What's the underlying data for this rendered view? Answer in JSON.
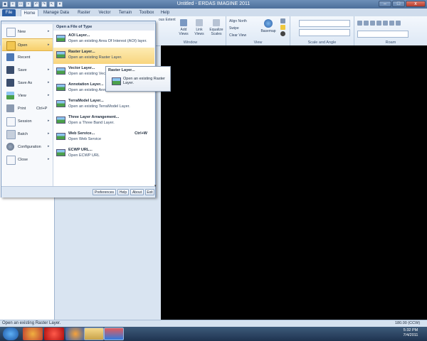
{
  "window": {
    "title": "Untitled - ERDAS IMAGINE 2011"
  },
  "tabs": [
    "File",
    "Home",
    "Manage Data",
    "Raster",
    "Vector",
    "Terrain",
    "Toolbox",
    "Help"
  ],
  "ribbon": {
    "groups": [
      "Window",
      "View",
      "Scale and Angle",
      "Roam"
    ],
    "buttons": {
      "add_views": "Add Views",
      "link_views": "Link Views",
      "equalize_scales": "Equalize Scales",
      "align_north": "Align North",
      "swipe": "Swipe",
      "clear_view": "Clear View",
      "basemap": "Basemap",
      "fit_extent": "ous Extent"
    }
  },
  "file_menu": {
    "commands": [
      {
        "label": "New",
        "shortcut": "",
        "arrow": "▸"
      },
      {
        "label": "Open",
        "shortcut": "",
        "arrow": "▸"
      },
      {
        "label": "Recent",
        "shortcut": "",
        "arrow": ""
      },
      {
        "label": "Save",
        "shortcut": "",
        "arrow": "▸"
      },
      {
        "label": "Save As",
        "shortcut": "",
        "arrow": "▸"
      },
      {
        "label": "View",
        "shortcut": "",
        "arrow": "▸"
      },
      {
        "label": "Print",
        "shortcut": "Ctrl+P",
        "arrow": ""
      },
      {
        "label": "Session",
        "shortcut": "",
        "arrow": "▸"
      },
      {
        "label": "Batch",
        "shortcut": "",
        "arrow": "▸"
      },
      {
        "label": "Configuration",
        "shortcut": "",
        "arrow": "▸"
      },
      {
        "label": "Close",
        "shortcut": "",
        "arrow": "▸"
      }
    ],
    "submenu_header": "Open a File of Type",
    "submenu_items": [
      {
        "title": "AOI Layer...",
        "desc": "Open an existing Area Of Interest (AOI) layer.",
        "shortcut": ""
      },
      {
        "title": "Raster Layer...",
        "desc": "Open an existing Raster Layer.",
        "shortcut": ""
      },
      {
        "title": "Vector Layer...",
        "desc": "Open an existing Vect",
        "shortcut": ""
      },
      {
        "title": "Annotation Layer...",
        "desc": "Open an existing Annotation Layer.",
        "shortcut": ""
      },
      {
        "title": "TerraModel Layer...",
        "desc": "Open an existing TerraModel Layer.",
        "shortcut": ""
      },
      {
        "title": "Three Layer Arrangement...",
        "desc": "Open a Three Band Layer.",
        "shortcut": ""
      },
      {
        "title": "Web Service...",
        "desc": "Open Web Service",
        "shortcut": "Ctrl+W"
      },
      {
        "title": "ECWP URL...",
        "desc": "Open ECWP URL",
        "shortcut": ""
      }
    ],
    "scroll_arrow": "▾",
    "buttons": [
      "Preferences",
      "Help",
      "About",
      "Exit"
    ]
  },
  "tooltip": {
    "title": "Raster Layer...",
    "desc": "Open an existing Raster Layer."
  },
  "status": {
    "text": "Open an existing Raster Layer.",
    "angle": "180.00 (CCW)"
  },
  "taskbar": {
    "time": "5:32 PM",
    "date": "7/4/2011"
  },
  "glyphs": {
    "minimize": "–",
    "maximize": "□",
    "close": "x"
  }
}
